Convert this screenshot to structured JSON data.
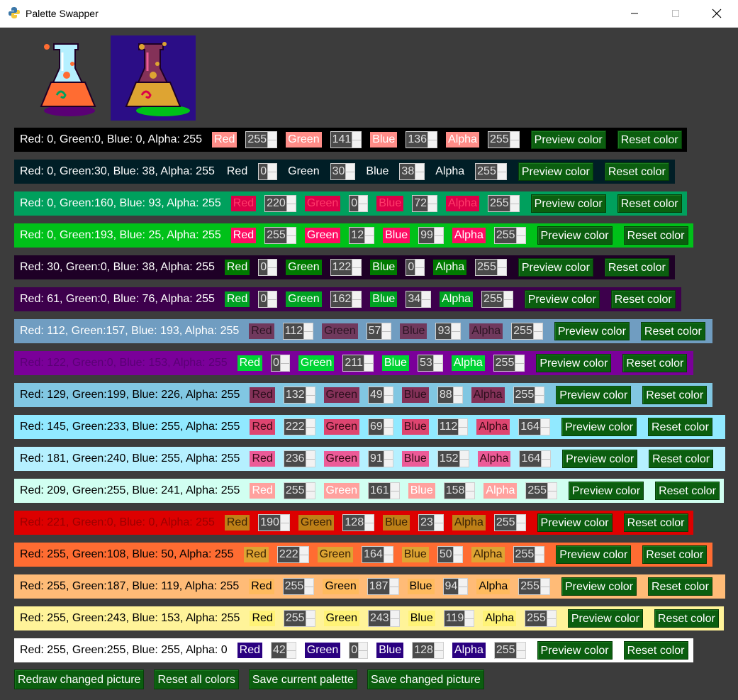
{
  "window": {
    "title": "Palette Swapper"
  },
  "labels": {
    "red": "Red",
    "green": "Green",
    "blue": "Blue",
    "alpha": "Alpha",
    "preview": "Preview color",
    "reset": "Reset color"
  },
  "rows": [
    {
      "desc": "Red: 0, Green:0, Blue: 0, Alpha: 255",
      "bg": "#000000",
      "fg": "#ffffff",
      "lblbg": "#ff8d88",
      "lblfg": "#ffffff",
      "r": "255",
      "g": "141",
      "b": "136",
      "a": "255",
      "width": 949
    },
    {
      "desc": "Red: 0, Green:30, Blue: 38, Alpha: 255",
      "bg": "#001e26",
      "fg": "#ffffff",
      "lblbg": "#001e26",
      "lblfg": "#ffffff",
      "r": "0",
      "g": "30",
      "b": "38",
      "a": "255",
      "width": 932
    },
    {
      "desc": "Red: 0, Green:160, Blue: 93, Alpha: 255",
      "bg": "#00a05d",
      "fg": "#ffffff",
      "lblbg": "#dc0048",
      "lblfg": "#ff3a6a",
      "r": "220",
      "g": "0",
      "b": "72",
      "a": "255",
      "width": 949
    },
    {
      "desc": "Red: 0, Green:193, Blue: 25, Alpha: 255",
      "bg": "#00c119",
      "fg": "#ffffff",
      "lblbg": "#ff0c63",
      "lblfg": "#ffffff",
      "r": "255",
      "g": "12",
      "b": "99",
      "a": "255",
      "width": 958
    },
    {
      "desc": "Red: 30, Green:0, Blue: 38, Alpha: 255",
      "bg": "#1e0026",
      "fg": "#ffffff",
      "lblbg": "#007a00",
      "lblfg": "#ffffff",
      "r": "0",
      "g": "122",
      "b": "0",
      "a": "255",
      "width": 932
    },
    {
      "desc": "Red: 61, Green:0, Blue: 76, Alpha: 255",
      "bg": "#3d004c",
      "fg": "#ffffff",
      "lblbg": "#00a222",
      "lblfg": "#ffffff",
      "r": "0",
      "g": "162",
      "b": "34",
      "a": "255",
      "width": 941
    },
    {
      "desc": "Red: 112, Green:157, Blue: 193, Alpha: 255",
      "bg": "#709dc1",
      "fg": "#ffffff",
      "lblbg": "#70395d",
      "lblfg": "#2d1524",
      "r": "112",
      "g": "57",
      "b": "93",
      "a": "255",
      "width": 985
    },
    {
      "desc": "Red: 122, Green:0, Blue: 153, Alpha: 255",
      "bg": "#7a0099",
      "fg": "#5a0075",
      "lblbg": "#00d335",
      "lblfg": "#ffffff",
      "r": "0",
      "g": "211",
      "b": "53",
      "a": "255",
      "width": 958
    },
    {
      "desc": "Red: 129, Green:199, Blue: 226, Alpha: 255",
      "bg": "#81c7e2",
      "fg": "#000000",
      "lblbg": "#843158",
      "lblfg": "#2d0f1e",
      "r": "132",
      "g": "49",
      "b": "88",
      "a": "255",
      "width": 985
    },
    {
      "desc": "Red: 145, Green:233, Blue: 255, Alpha: 255",
      "bg": "#91e9ff",
      "fg": "#000000",
      "lblbg": "#de4570",
      "lblfg": "#3a0a16",
      "r": "222",
      "g": "69",
      "b": "112",
      "a": "164",
      "width": 1003
    },
    {
      "desc": "Red: 181, Green:240, Blue: 255, Alpha: 255",
      "bg": "#b5f0ff",
      "fg": "#000000",
      "lblbg": "#ec5b98",
      "lblfg": "#3a0a16",
      "r": "236",
      "g": "91",
      "b": "152",
      "a": "164",
      "width": 1003
    },
    {
      "desc": "Red: 209, Green:255, Blue: 241, Alpha: 255",
      "bg": "#d1fff1",
      "fg": "#000000",
      "lblbg": "#ffa19e",
      "lblfg": "#ffffff",
      "r": "255",
      "g": "161",
      "b": "158",
      "a": "255",
      "width": 1001
    },
    {
      "desc": "Red: 221, Green:0, Blue: 0, Alpha: 255",
      "bg": "#dd0000",
      "fg": "#9a0000",
      "lblbg": "#be8017",
      "lblfg": "#3a2205",
      "r": "190",
      "g": "128",
      "b": "23",
      "a": "255",
      "width": 958
    },
    {
      "desc": "Red: 255, Green:108, Blue: 50, Alpha: 255",
      "bg": "#ff6c32",
      "fg": "#000000",
      "lblbg": "#dea432",
      "lblfg": "#3a2205",
      "r": "222",
      "g": "164",
      "b": "50",
      "a": "255",
      "width": 985
    },
    {
      "desc": "Red: 255, Green:187, Blue: 119, Alpha: 255",
      "bg": "#ffbb77",
      "fg": "#000000",
      "lblbg": "#ffbb5e",
      "lblfg": "#000000",
      "r": "255",
      "g": "187",
      "b": "94",
      "a": "255",
      "width": 1003
    },
    {
      "desc": "Red: 255, Green:243, Blue: 153, Alpha: 255",
      "bg": "#fff399",
      "fg": "#000000",
      "lblbg": "#fff377",
      "lblfg": "#000000",
      "r": "255",
      "g": "243",
      "b": "119",
      "a": "255",
      "width": 1001
    },
    {
      "desc": "Red: 255, Green:255, Blue: 255, Alpha: 0",
      "bg": "#ffffff",
      "fg": "#000000",
      "lblbg": "#2a0080",
      "lblfg": "#ffffff",
      "r": "42",
      "g": "0",
      "b": "128",
      "a": "255",
      "width": 958
    }
  ],
  "bottom": {
    "redraw": "Redraw changed picture",
    "reset_all": "Reset all colors",
    "save_palette": "Save current palette",
    "save_picture": "Save changed picture"
  }
}
